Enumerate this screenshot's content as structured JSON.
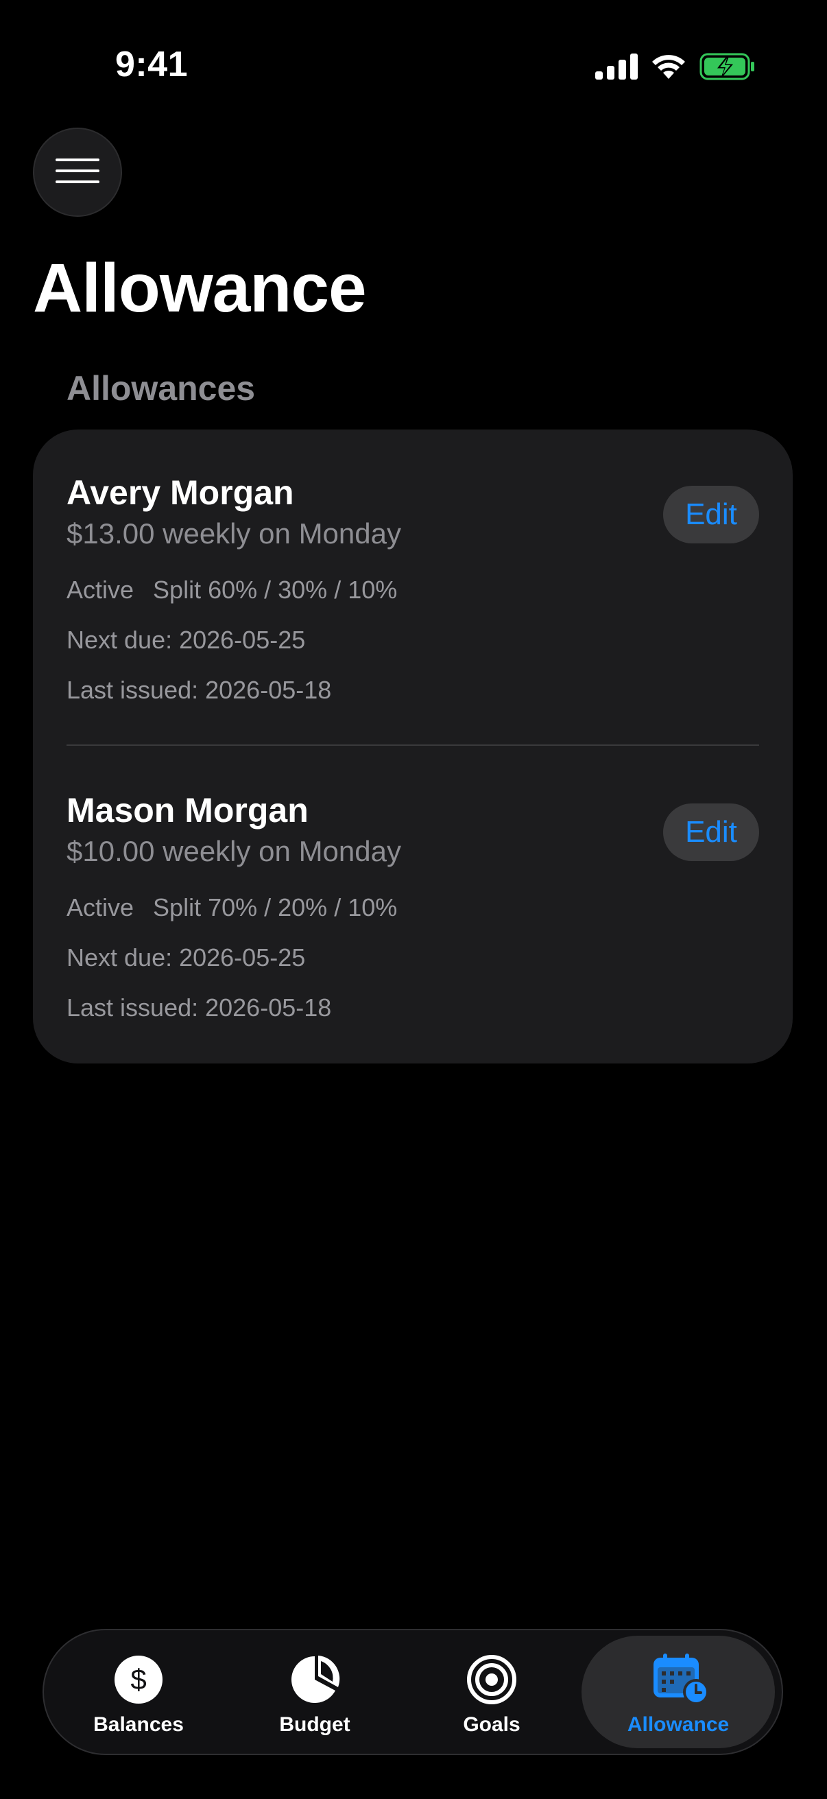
{
  "status_bar": {
    "time": "9:41"
  },
  "header": {
    "menu_icon": "hamburger-icon",
    "title": "Allowance"
  },
  "section": {
    "title": "Allowances"
  },
  "allowances": [
    {
      "name": "Avery Morgan",
      "amount": "$13.00 weekly on Monday",
      "status": "Active",
      "split": "Split 60% / 30% / 10%",
      "next_due": "Next due: 2026-05-25",
      "last_issued": "Last issued: 2026-05-18",
      "edit_label": "Edit"
    },
    {
      "name": "Mason Morgan",
      "amount": "$10.00 weekly on Monday",
      "status": "Active",
      "split": "Split 70% / 20% / 10%",
      "next_due": "Next due: 2026-05-25",
      "last_issued": "Last issued: 2026-05-18",
      "edit_label": "Edit"
    }
  ],
  "tab_bar": {
    "tabs": [
      {
        "label": "Balances",
        "icon": "dollar-circle-icon",
        "selected": false
      },
      {
        "label": "Budget",
        "icon": "pie-chart-icon",
        "selected": false
      },
      {
        "label": "Goals",
        "icon": "target-icon",
        "selected": false
      },
      {
        "label": "Allowance",
        "icon": "calendar-clock-icon",
        "selected": true
      }
    ]
  },
  "colors": {
    "background": "#000000",
    "card": "#1c1c1e",
    "accent": "#1a8cff",
    "secondary_text": "#8e8e93",
    "battery": "#34c759"
  }
}
